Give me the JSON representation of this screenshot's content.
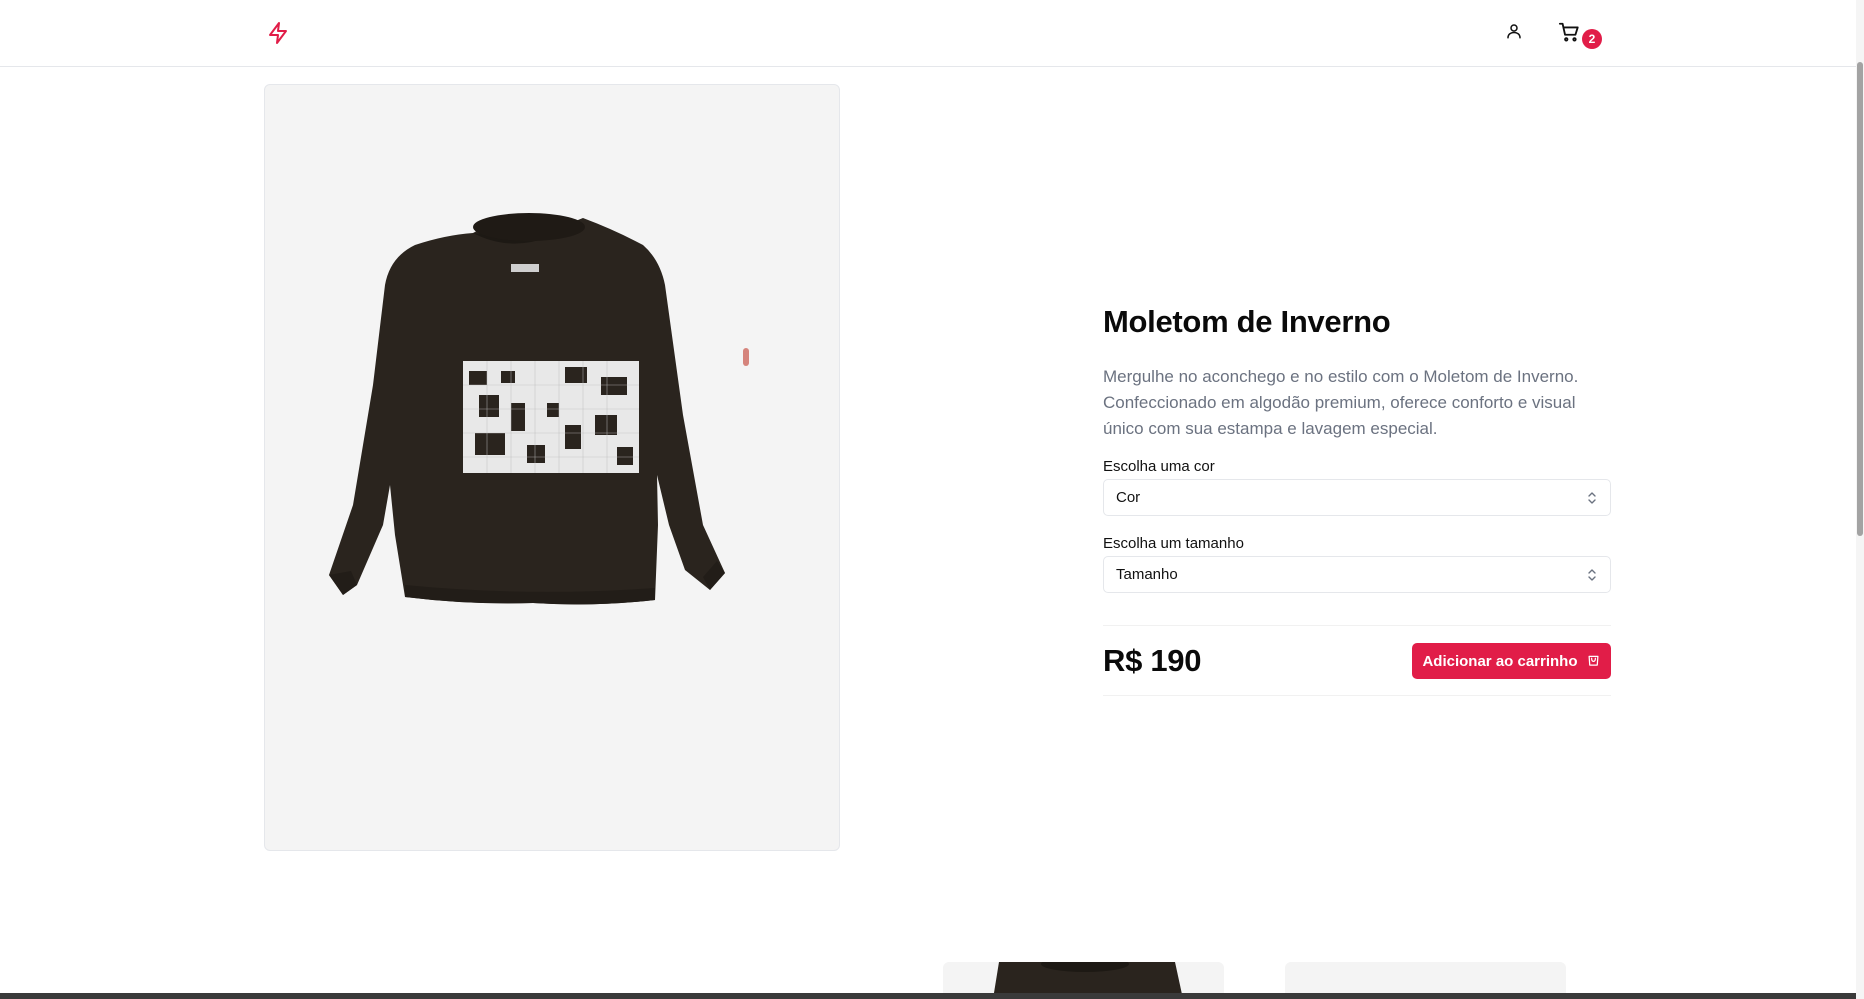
{
  "header": {
    "logo_icon": "bolt-icon",
    "user_icon": "user-icon",
    "cart_icon": "cart-icon",
    "cart_count": "2"
  },
  "product": {
    "image_alt": "sweatshirt-photo",
    "title": "Moletom de Inverno",
    "description": "Mergulhe no aconchego e no estilo com o Moletom de Inverno. Confeccionado em algodão premium, oferece conforto e visual único com sua estampa e lavagem especial.",
    "color_label": "Escolha uma cor",
    "color_value": "Cor",
    "size_label": "Escolha um tamanho",
    "size_value": "Tamanho",
    "price": "R$ 190",
    "add_to_cart_label": "Adicionar ao carrinho"
  },
  "colors": {
    "accent": "#e11d48",
    "image_background": "#f4f4f4",
    "muted_text": "#6b7280"
  }
}
